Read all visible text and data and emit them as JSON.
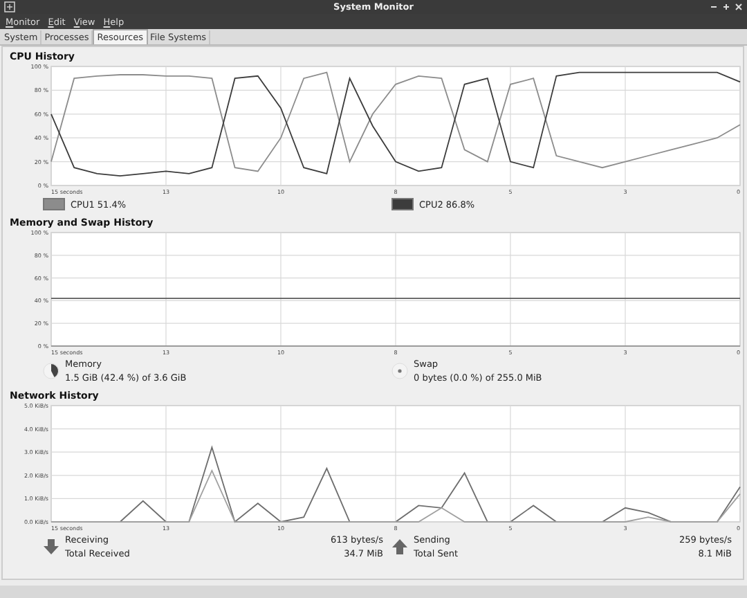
{
  "window": {
    "title": "System Monitor"
  },
  "menu": [
    {
      "label": "Monitor"
    },
    {
      "label": "Edit"
    },
    {
      "label": "View"
    },
    {
      "label": "Help"
    }
  ],
  "tabs": [
    {
      "label": "System",
      "selected": false
    },
    {
      "label": "Processes",
      "selected": false
    },
    {
      "label": "Resources",
      "selected": true
    },
    {
      "label": "File Systems",
      "selected": false
    }
  ],
  "sections": [
    {
      "title": "CPU History",
      "chart_data": {
        "type": "line",
        "xlim": [
          15,
          0
        ],
        "ylim": [
          0,
          100
        ],
        "grid": true,
        "xticks": [
          {
            "value": 15,
            "label": "15 seconds"
          },
          {
            "value": 12.5,
            "label": "13"
          },
          {
            "value": 10,
            "label": "10"
          },
          {
            "value": 7.5,
            "label": "8"
          },
          {
            "value": 5,
            "label": "5"
          },
          {
            "value": 2.5,
            "label": "3"
          },
          {
            "value": 0,
            "label": "0"
          }
        ],
        "yticks": [
          {
            "value": 0,
            "label": "0 %"
          },
          {
            "value": 20,
            "label": "20 %"
          },
          {
            "value": 40,
            "label": "40 %"
          },
          {
            "value": 60,
            "label": "60 %"
          },
          {
            "value": 80,
            "label": "80 %"
          },
          {
            "value": 100,
            "label": "100 %"
          }
        ],
        "x": [
          15,
          14.5,
          14,
          13.5,
          13,
          12.5,
          12,
          11.5,
          11,
          10.5,
          10,
          9.5,
          9,
          8.5,
          8,
          7.5,
          7,
          6.5,
          6,
          5.5,
          5,
          4.5,
          4,
          3.5,
          3,
          2.5,
          2,
          1.5,
          1,
          0.5,
          0
        ],
        "series": [
          {
            "name": "CPU1",
            "color": "#8c8c8c",
            "values": [
              20,
              90,
              92,
              93,
              93,
              92,
              92,
              90,
              15,
              12,
              40,
              90,
              95,
              20,
              60,
              85,
              92,
              90,
              30,
              20,
              85,
              90,
              25,
              20,
              15,
              20,
              25,
              30,
              35,
              40,
              51
            ]
          },
          {
            "name": "CPU2",
            "color": "#3c3c3c",
            "values": [
              60,
              15,
              10,
              8,
              10,
              12,
              10,
              15,
              90,
              92,
              65,
              15,
              10,
              90,
              50,
              20,
              12,
              15,
              85,
              90,
              20,
              15,
              92,
              95,
              95,
              95,
              95,
              95,
              95,
              95,
              87
            ]
          }
        ]
      },
      "legend": [
        {
          "kind": "swatch",
          "value": "51.4%"
        },
        {
          "kind": "swatch",
          "value": "86.8%"
        }
      ]
    },
    {
      "title": "Memory and Swap History",
      "chart_data": {
        "type": "line",
        "xlim": [
          15,
          0
        ],
        "ylim": [
          0,
          100
        ],
        "grid": true,
        "xticks": [
          {
            "value": 15,
            "label": "15 seconds"
          },
          {
            "value": 12.5,
            "label": "13"
          },
          {
            "value": 10,
            "label": "10"
          },
          {
            "value": 7.5,
            "label": "8"
          },
          {
            "value": 5,
            "label": "5"
          },
          {
            "value": 2.5,
            "label": "3"
          },
          {
            "value": 0,
            "label": "0"
          }
        ],
        "yticks": [
          {
            "value": 0,
            "label": "0 %"
          },
          {
            "value": 20,
            "label": "20 %"
          },
          {
            "value": 40,
            "label": "40 %"
          },
          {
            "value": 60,
            "label": "60 %"
          },
          {
            "value": 80,
            "label": "80 %"
          },
          {
            "value": 100,
            "label": "100 %"
          }
        ],
        "x": [
          15,
          0
        ],
        "series": [
          {
            "name": "Memory",
            "color": "#5a5a5a",
            "values": [
              42,
              42
            ]
          },
          {
            "name": "Swap",
            "color": "#9a9a9a",
            "values": [
              0,
              0
            ]
          }
        ]
      },
      "legend": [
        {
          "kind": "pie",
          "detail": "1.5 GiB (42.4 %) of 3.6 GiB",
          "level": 0.424
        },
        {
          "kind": "pie",
          "detail": "0 bytes (0.0 %) of 255.0 MiB"
        }
      ]
    },
    {
      "title": "Network History",
      "chart_data": {
        "type": "line",
        "xlim": [
          15,
          0
        ],
        "ylim": [
          0,
          5
        ],
        "grid": true,
        "xticks": [
          {
            "value": 15,
            "label": "15 seconds"
          },
          {
            "value": 12.5,
            "label": "13"
          },
          {
            "value": 10,
            "label": "10"
          },
          {
            "value": 7.5,
            "label": "8"
          },
          {
            "value": 5,
            "label": "5"
          },
          {
            "value": 2.5,
            "label": "3"
          },
          {
            "value": 0,
            "label": "0"
          }
        ],
        "yticks": [
          {
            "value": 0,
            "label": "0.0 KiB/s"
          },
          {
            "value": 1,
            "label": "1.0 KiB/s"
          },
          {
            "value": 2,
            "label": "2.0 KiB/s"
          },
          {
            "value": 3,
            "label": "3.0 KiB/s"
          },
          {
            "value": 4,
            "label": "4.0 KiB/s"
          },
          {
            "value": 5,
            "label": "5.0 KiB/s"
          }
        ],
        "x": [
          15,
          14.5,
          14,
          13.5,
          13,
          12.5,
          12,
          11.5,
          11,
          10.5,
          10,
          9.5,
          9,
          8.5,
          8,
          7.5,
          7,
          6.5,
          6,
          5.5,
          5,
          4.5,
          4,
          3.5,
          3,
          2.5,
          2,
          1.5,
          1,
          0.5,
          0
        ],
        "series": [
          {
            "name": "Receiving",
            "color": "#6e6e6e",
            "values": [
              0,
              0,
              0,
              0,
              0.9,
              0,
              0,
              3.2,
              0,
              0.8,
              0,
              0.2,
              2.3,
              0,
              0,
              0,
              0.7,
              0.6,
              2.1,
              0,
              0,
              0.7,
              0,
              0,
              0,
              0.6,
              0.4,
              0,
              0,
              0,
              1.5
            ]
          },
          {
            "name": "Sending",
            "color": "#a0a0a0",
            "values": [
              0,
              0,
              0,
              0,
              0,
              0,
              0,
              2.2,
              0,
              0,
              0,
              0,
              0,
              0,
              0,
              0,
              0,
              0.6,
              0,
              0,
              0,
              0,
              0,
              0,
              0,
              0,
              0.2,
              0,
              0,
              0,
              1.2
            ]
          }
        ]
      },
      "legend": [
        {
          "kind": "down",
          "rate": "613 bytes/s",
          "total_label": "Total Received",
          "total": "34.7 MiB"
        },
        {
          "kind": "up",
          "rate": "259 bytes/s",
          "total_label": "Total Sent",
          "total": "8.1 MiB"
        }
      ]
    }
  ]
}
